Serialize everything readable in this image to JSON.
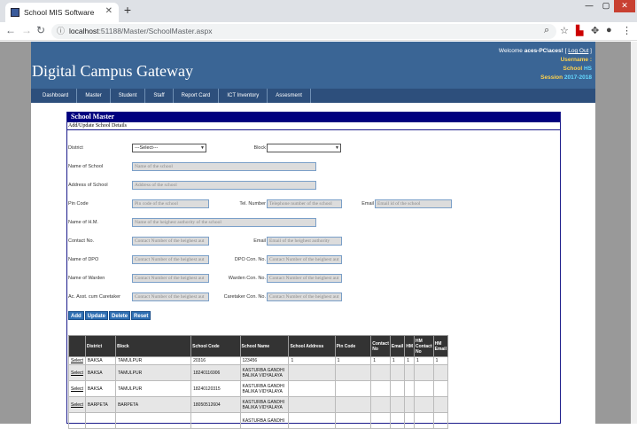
{
  "browser": {
    "tab_title": "School MIS Software",
    "tab_close": "✕",
    "new_tab": "+",
    "url_host": "localhost",
    "url_path": ":51188/Master/SchoolMaster.aspx",
    "controls": {
      "minimize": "—",
      "maximize": "▢",
      "close": "✕"
    }
  },
  "header": {
    "brand": "Digital Campus Gateway",
    "welcome_prefix": "Welcome",
    "welcome_user": "aces-PC\\aces!",
    "logout": "Log Out",
    "username_label": "Username :",
    "school_label": "School",
    "school_value": "HS",
    "session_label": "Session",
    "session_value": "2017-2018"
  },
  "menu": [
    "Dashboard",
    "Master",
    "Student",
    "Staff",
    "Report Card",
    "ICT Inventory",
    "Assesment"
  ],
  "panel": {
    "title": "School Master",
    "subtitle": "Add/Update School Details"
  },
  "form": {
    "district_label": "District",
    "district_value": "---Select---",
    "block_label": "Block",
    "block_value": "",
    "name_label": "Name of School",
    "name_ph": "Name of the school",
    "address_label": "Address of School",
    "address_ph": "Address of the school",
    "pin_label": "Pin Code",
    "pin_ph": "Pin code of the school",
    "tel_label": "Tel. Number",
    "tel_ph": "Telephone number of the school",
    "email_label": "Email",
    "email_ph": "Email id of the school",
    "hm_label": "Name of H.M.",
    "hm_ph": "Name of the heighest authority of the school",
    "contact_label": "Contact No.",
    "contact_ph": "Contact Number of the heighest aut",
    "email2_label": "Email",
    "email2_ph": "Email of the heighest authority",
    "dpo_label": "Name of DPO",
    "dpo_ph": "Contact Number of the heighest aut",
    "dpo_con_label": "DPO Con. No.",
    "dpo_con_ph": "Contact Number of the heighest aut",
    "warden_label": "Name of Warden",
    "warden_ph": "Contact Number of the heighest aut",
    "warden_con_label": "Warden Con. No.",
    "warden_con_ph": "Contact Number of the heighest aut",
    "care_label": "Ac. Asst. cum Caretaker",
    "care_ph": "Contact Number of the heighest aut",
    "care_con_label": "Caretaker Con. No.",
    "care_con_ph": "Contact Number of the heighest aut"
  },
  "buttons": {
    "add": "Add",
    "update": "Update",
    "delete": "Delete",
    "reset": "Reset"
  },
  "grid": {
    "headers": [
      "",
      "District",
      "Block",
      "School Code",
      "School Name",
      "School Address",
      "Pin Code",
      "Contact No",
      "Email",
      "HM",
      "HM Contact No",
      "HM Email"
    ],
    "rows": [
      [
        "Select",
        "BAKSA",
        "TAMULPUR",
        "20316",
        "123456",
        "1",
        "1",
        "1",
        "1",
        "1",
        "1",
        "1"
      ],
      [
        "Select",
        "BAKSA",
        "TAMULPUR",
        "18240116906",
        "KASTURBA GANDHI BALIKA VIDYALAYA",
        "",
        "",
        "",
        "",
        "",
        "",
        ""
      ],
      [
        "Select",
        "BAKSA",
        "TAMULPUR",
        "18240120315",
        "KASTURBA GANDHI BALIKA VIDYALAYA",
        "",
        "",
        "",
        "",
        "",
        "",
        ""
      ],
      [
        "Select",
        "BARPETA",
        "BARPETA",
        "18050512604",
        "KASTURBA GANDHI BALIKA VIDYALAYA",
        "",
        "",
        "",
        "",
        "",
        "",
        ""
      ],
      [
        "",
        "",
        "",
        "",
        "KASTURBA GANDHI",
        "",
        "",
        "",
        "",
        "",
        "",
        ""
      ]
    ]
  }
}
